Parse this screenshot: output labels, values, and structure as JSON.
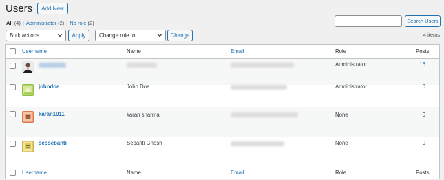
{
  "header": {
    "title": "Users",
    "add_new": "Add New"
  },
  "filters": {
    "all": "All",
    "all_count": "(4)",
    "admin": "Administrator",
    "admin_count": "(2)",
    "norole": "No role",
    "norole_count": "(2)",
    "sep": "|"
  },
  "search": {
    "placeholder": "",
    "button": "Search Users"
  },
  "bulk": {
    "selected": "Bulk actions",
    "apply": "Apply"
  },
  "role_change": {
    "selected": "Change role to...",
    "button": "Change"
  },
  "item_count": "4 items",
  "columns": {
    "username": "Username",
    "name": "Name",
    "email": "Email",
    "role": "Role",
    "posts": "Posts"
  },
  "rows": [
    {
      "username": "",
      "name": "",
      "role": "Administrator",
      "posts": "16"
    },
    {
      "username": "johndoe",
      "name": "John Doe",
      "role": "Administrator",
      "posts": "0"
    },
    {
      "username": "karan1011",
      "name": "karan sharma",
      "role": "None",
      "posts": "0"
    },
    {
      "username": "seosebanti",
      "name": "Sebanti Ghosh",
      "role": "None",
      "posts": "0"
    }
  ],
  "colors": {
    "accent": "#2271b1",
    "text": "#3c434a",
    "border": "#c3c4c7",
    "background": "#f0f0f1"
  }
}
